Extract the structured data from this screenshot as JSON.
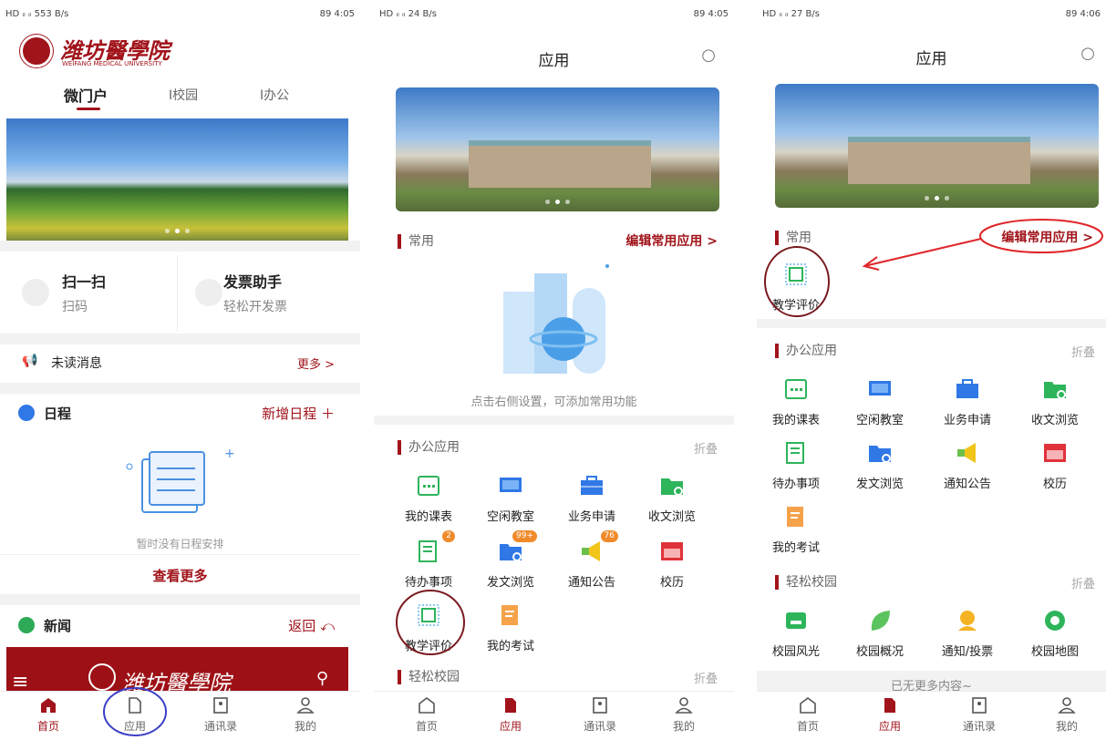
{
  "s1": {
    "status_left": "HD ᵢₗ ᵢₗ 553 B/s",
    "status_right": "89 4:05",
    "logo_cn": "潍坊醫學院",
    "logo_en": "WEIFANG MEDICAL UNIVERSITY",
    "tabs": [
      "微门户",
      "I校园",
      "I办公"
    ],
    "quick": [
      {
        "title": "扫一扫",
        "sub": "扫码"
      },
      {
        "title": "发票助手",
        "sub": "轻松开发票"
      }
    ],
    "unread_label": "未读消息",
    "unread_more": "更多 >",
    "schedule_title": "日程",
    "schedule_add": "新增日程 ＋",
    "schedule_empty": "暂时没有日程安排",
    "see_more": "查看更多",
    "news_title": "新闻",
    "news_back": "返回 ⤺",
    "news_banner_text": "潍坊醫學院"
  },
  "s2": {
    "status_left": "HD ᵢₗ ᵢₗ 24 B/s",
    "status_right": "89 4:05",
    "title": "应用",
    "common_label": "常用",
    "edit_common": "编辑常用应用 >",
    "empty_hint": "点击右侧设置，可添加常用功能",
    "office_label": "办公应用",
    "fold": "折叠",
    "apps": [
      "我的课表",
      "空闲教室",
      "业务申请",
      "收文浏览",
      "待办事项",
      "发文浏览",
      "通知公告",
      "校历",
      "教学评价",
      "我的考试"
    ],
    "badges": {
      "todo": "2",
      "doc": "99+",
      "notice": "76"
    },
    "campus_label": "轻松校园",
    "fold2": "折叠"
  },
  "s3": {
    "status_left": "HD ᵢₗ ᵢₗ 27 B/s",
    "status_right": "89 4:06",
    "title": "应用",
    "common_label": "常用",
    "edit_common": "编辑常用应用 >",
    "common_app": "教学评价",
    "office_label": "办公应用",
    "fold": "折叠",
    "apps": [
      "我的课表",
      "空闲教室",
      "业务申请",
      "收文浏览",
      "待办事项",
      "发文浏览",
      "通知公告",
      "校历",
      "我的考试"
    ],
    "campus_label": "轻松校园",
    "fold2": "折叠",
    "campus_apps": [
      "校园风光",
      "校园概况",
      "通知/投票",
      "校园地图"
    ],
    "no_more": "已无更多内容~"
  },
  "tabbar": [
    "首页",
    "应用",
    "通讯录",
    "我的"
  ],
  "colors": {
    "brand": "#a1141b",
    "annot_circle": "#7a1a1f",
    "annot_blue": "#3a3fc6",
    "annot_red": "#e0262b"
  }
}
